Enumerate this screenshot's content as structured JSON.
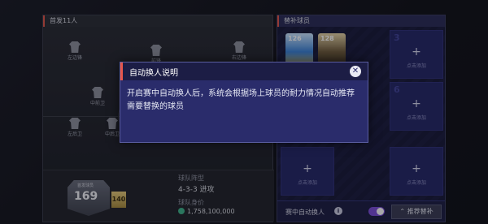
{
  "starters": {
    "title": "首发11人",
    "slots": [
      {
        "label": "左边锋"
      },
      {
        "label": "前锋"
      },
      {
        "label": "右边锋"
      },
      {
        "label": "中前卫"
      },
      {
        "label": "左后卫"
      },
      {
        "label": "中后卫"
      }
    ],
    "team": {
      "card_label": "首发球员",
      "rating": "169",
      "badge": "140",
      "formation_label": "球队阵型",
      "formation_value": "4-3-3 进攻",
      "value_label": "球队身价",
      "value_amount": "1,758,100,000"
    }
  },
  "subs": {
    "title": "替补球员",
    "cards": [
      {
        "ovr": "126"
      },
      {
        "ovr": "128"
      }
    ],
    "cells": [
      {
        "num": "3",
        "add": "点击添加"
      },
      {
        "num": "6",
        "add": "点击添加"
      },
      {
        "num": "",
        "add": "点击添加"
      },
      {
        "num": "",
        "add": "点击添加"
      }
    ],
    "plus_symbol": "+",
    "auto_sub_label": "赛中自动换人",
    "info_symbol": "i",
    "recommend_label": "推荐替补",
    "toggle_on": true
  },
  "modal": {
    "title": "自动换人说明",
    "close_symbol": "✕",
    "body": "开启赛中自动换人后，系统会根据场上球员的耐力情况自动推荐需要替换的球员"
  },
  "colors": {
    "accent_red": "#e6564b",
    "toggle_purple": "#7b4fd8",
    "modal_bg": "#2a2c6b"
  }
}
